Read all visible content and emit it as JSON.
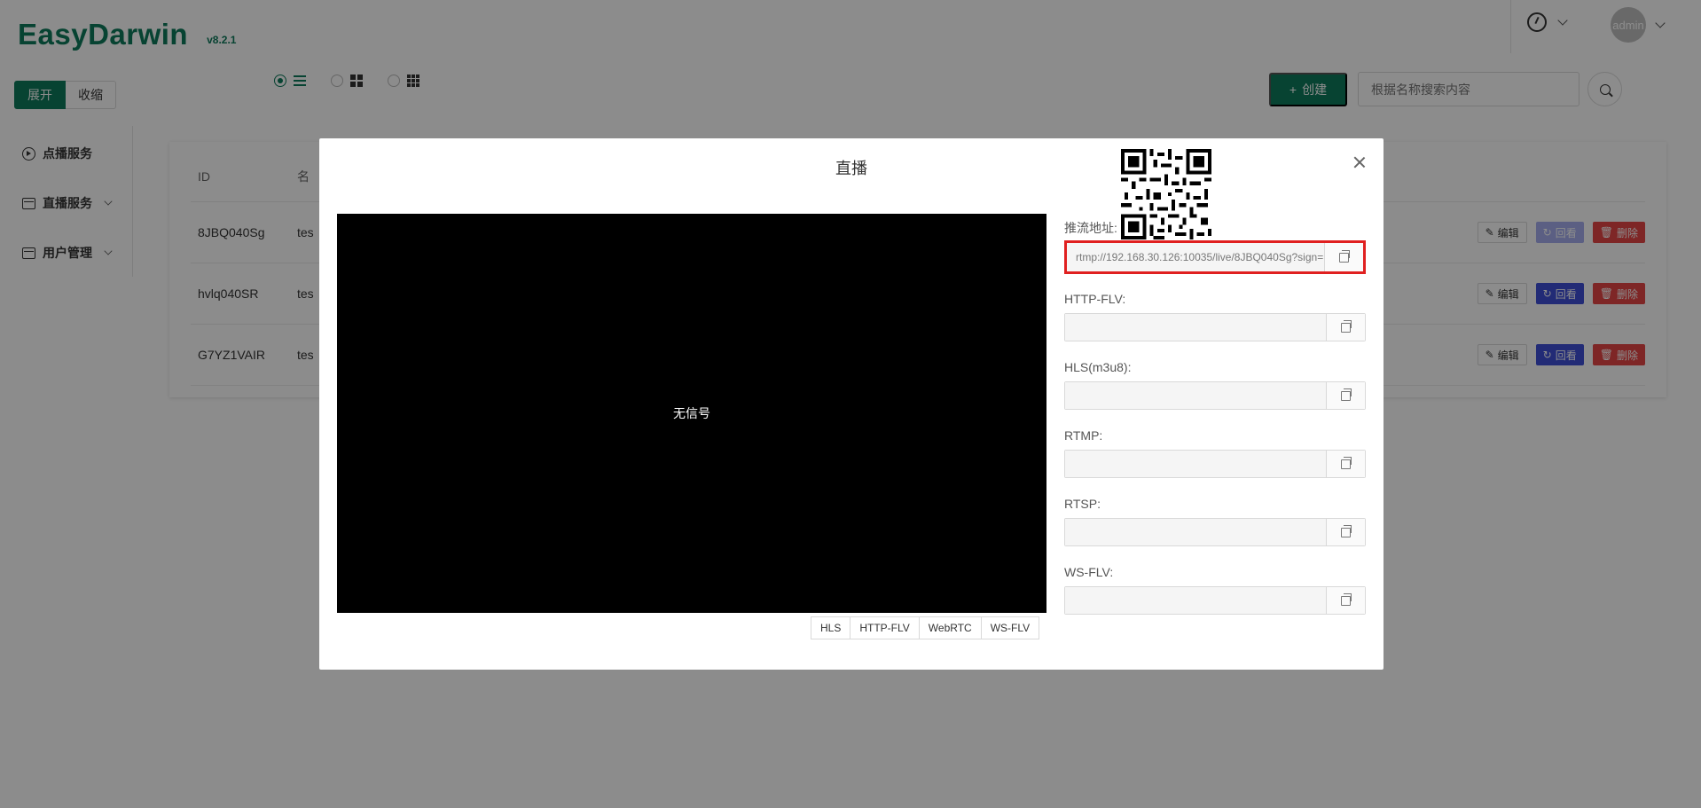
{
  "app": {
    "title": "EasyDarwin",
    "version": "v8.2.1"
  },
  "header": {
    "avatar_text": "admin"
  },
  "toolbar": {
    "expand_label": "展开",
    "collapse_label": "收缩",
    "create_label": "创建",
    "search_placeholder": "根据名称搜索内容"
  },
  "sidebar": {
    "items": [
      {
        "label": "点播服务",
        "icon": "play-circle-icon",
        "has_submenu": false
      },
      {
        "label": "直播服务",
        "icon": "folder-icon",
        "has_submenu": true
      },
      {
        "label": "用户管理",
        "icon": "folder-icon",
        "has_submenu": true
      }
    ]
  },
  "table": {
    "headers": {
      "id": "ID",
      "name": "名"
    },
    "rows": [
      {
        "id": "8JBQ040Sg",
        "name": "tes"
      },
      {
        "id": "hvlq040SR",
        "name": "tes"
      },
      {
        "id": "G7YZ1VAIR",
        "name": "tes"
      }
    ],
    "actions": {
      "edit": "编辑",
      "replay": "回看",
      "delete": "删除"
    }
  },
  "modal": {
    "title": "直播",
    "no_signal": "无信号",
    "protocol_tabs": [
      "HLS",
      "HTTP-FLV",
      "WebRTC",
      "WS-FLV"
    ],
    "urls": [
      {
        "label": "推流地址:",
        "value": "rtmp://192.168.30.126:10035/live/8JBQ040Sg?sign=",
        "highlighted": true
      },
      {
        "label": "HTTP-FLV:",
        "value": ""
      },
      {
        "label": "HLS(m3u8):",
        "value": ""
      },
      {
        "label": "RTMP:",
        "value": ""
      },
      {
        "label": "RTSP:",
        "value": ""
      },
      {
        "label": "WS-FLV:",
        "value": ""
      }
    ]
  },
  "colors": {
    "brand": "#0e7a5b",
    "replay": "#3f4fd8",
    "delete": "#e64545",
    "highlight": "#e02020"
  }
}
